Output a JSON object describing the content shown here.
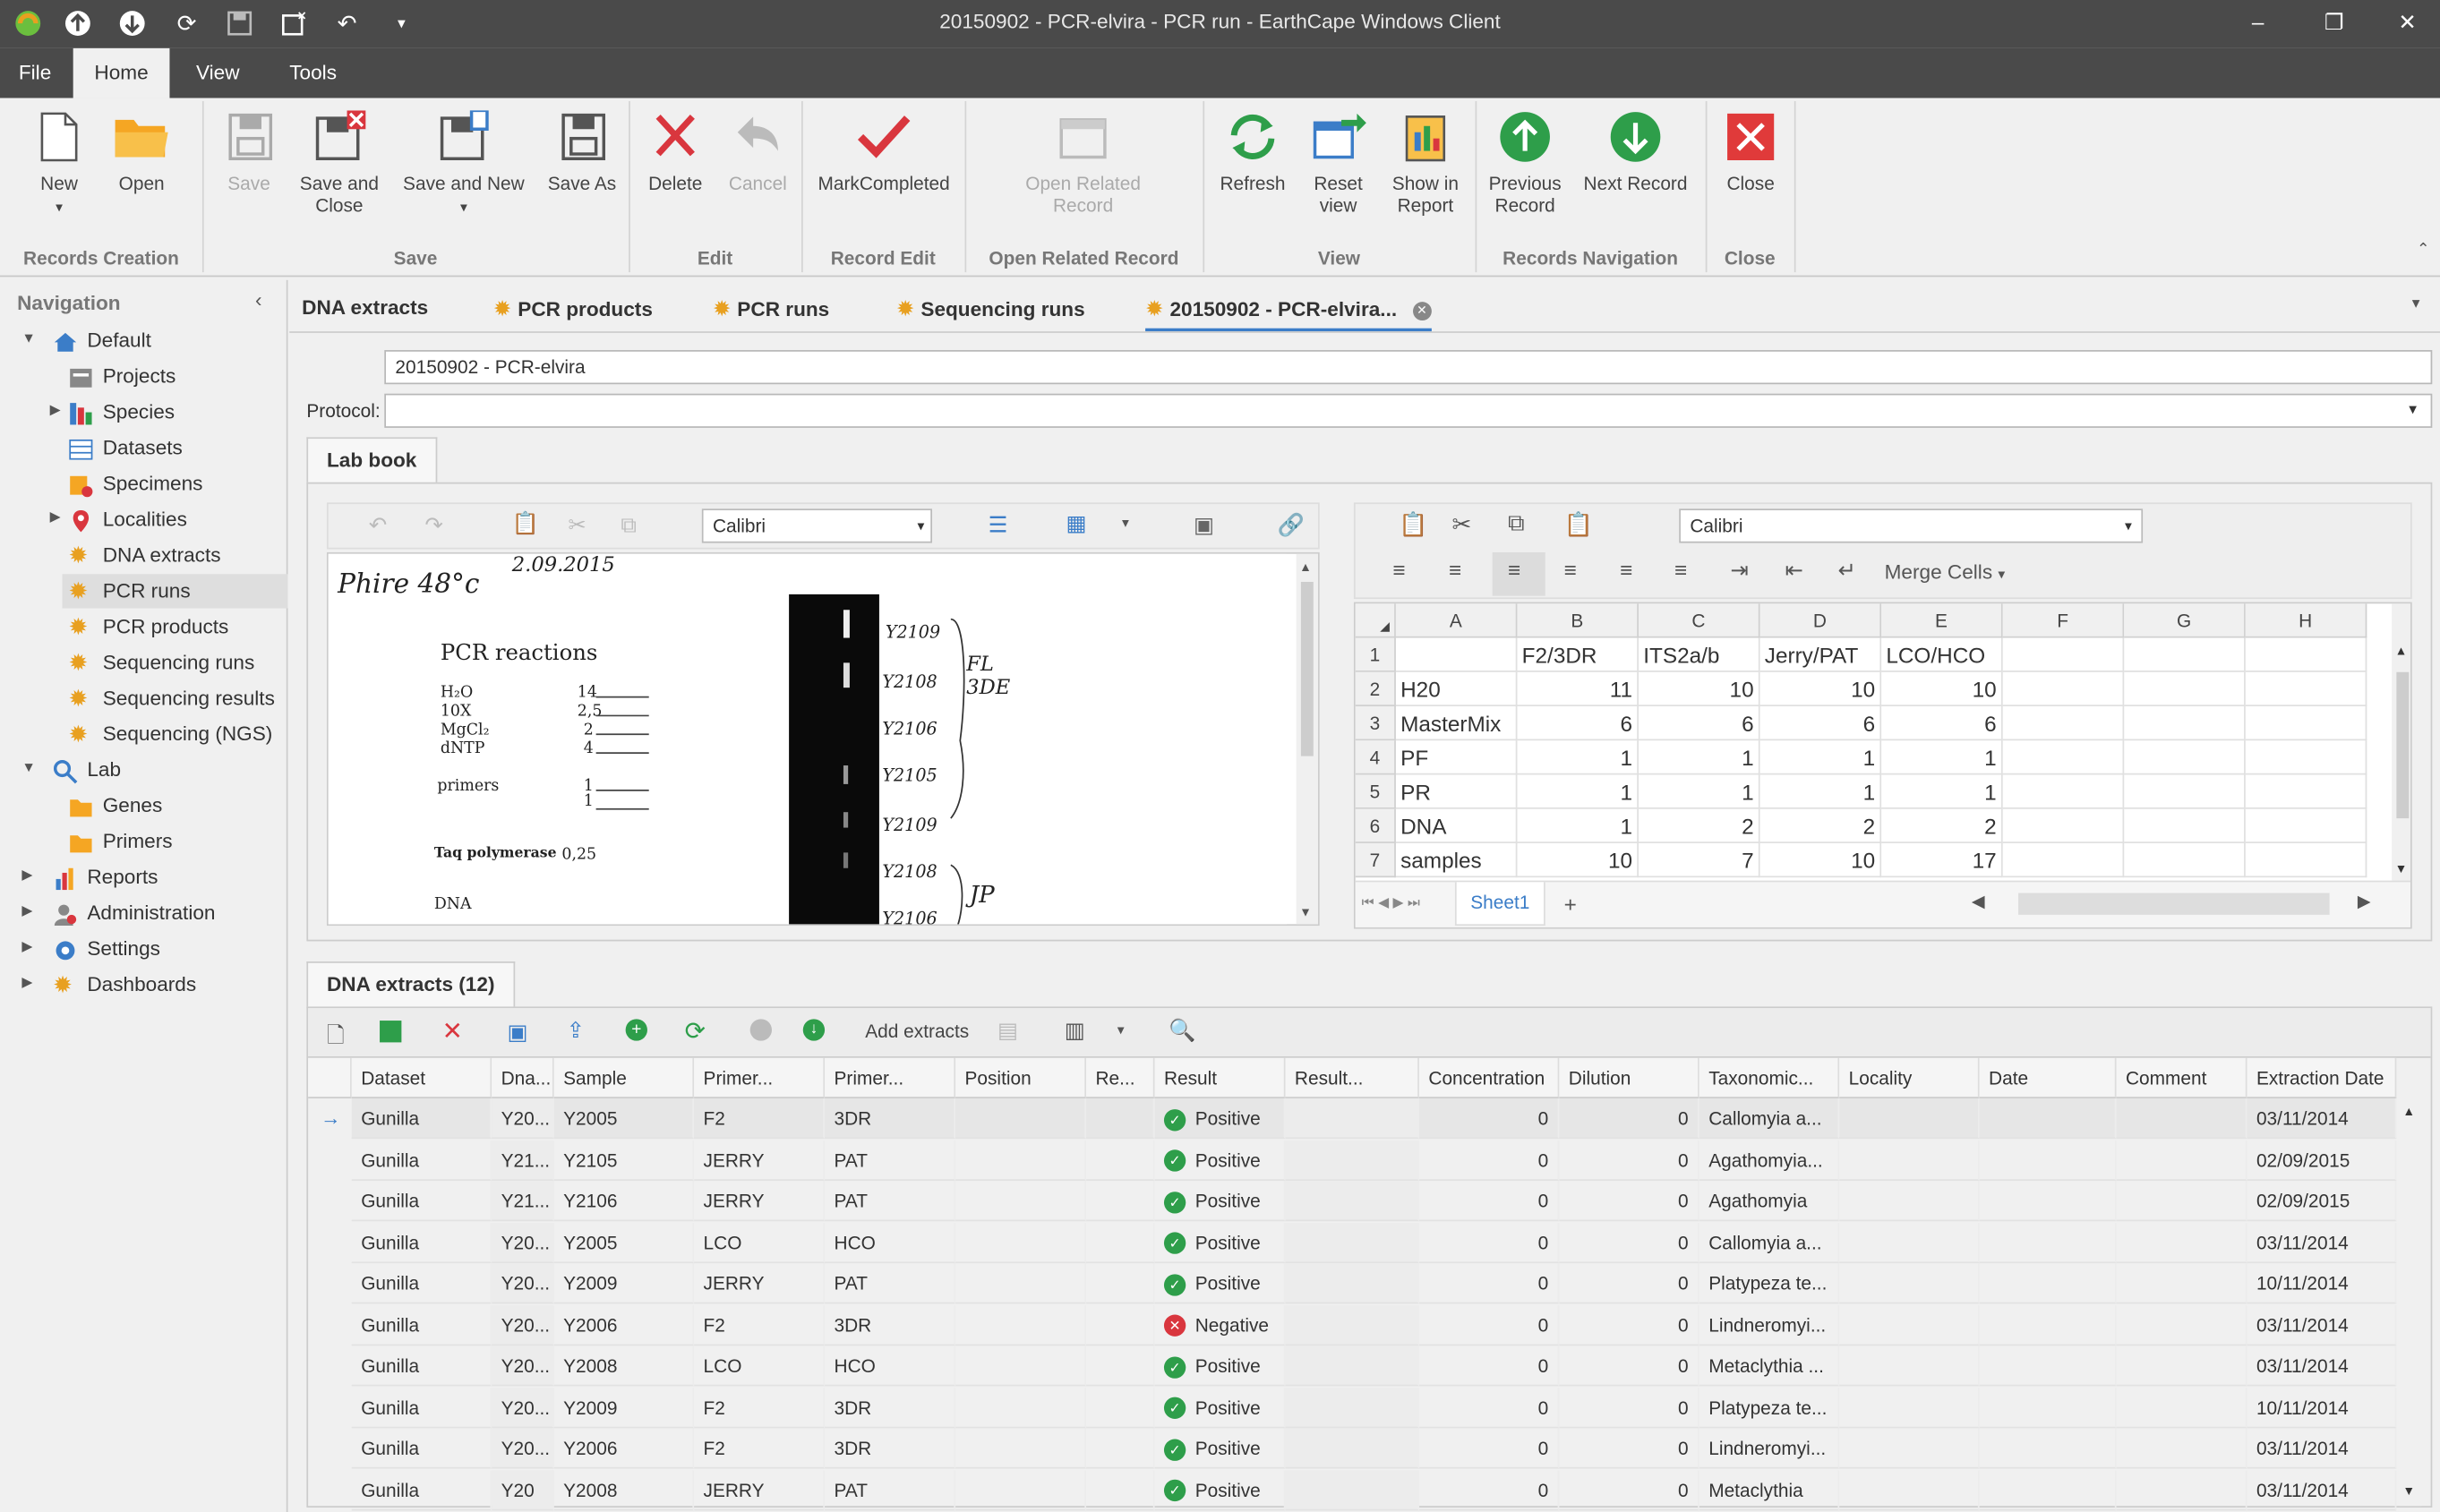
{
  "window": {
    "title": "20150902 - PCR-elvira - PCR run - EarthCape Windows Client",
    "minimize": "–",
    "restore": "❐",
    "close": "✕"
  },
  "menu": {
    "file": "File",
    "home": "Home",
    "view": "View",
    "tools": "Tools"
  },
  "ribbon": {
    "new": "New",
    "open": "Open",
    "save": "Save",
    "save_close": "Save and Close",
    "save_new": "Save and New",
    "save_as": "Save As",
    "delete": "Delete",
    "cancel": "Cancel",
    "mark_completed": "MarkCompleted",
    "open_related": "Open Related Record",
    "refresh": "Refresh",
    "reset_view": "Reset view",
    "show_report": "Show in Report",
    "previous": "Previous Record",
    "next": "Next Record",
    "close": "Close",
    "groups": {
      "records_creation": "Records Creation",
      "save": "Save",
      "edit": "Edit",
      "record_edit": "Record Edit",
      "open_related": "Open Related Record",
      "view": "View",
      "records_nav": "Records Navigation",
      "close": "Close"
    }
  },
  "nav": {
    "header": "Navigation",
    "items": [
      {
        "label": "Default"
      },
      {
        "label": "Projects"
      },
      {
        "label": "Species"
      },
      {
        "label": "Datasets"
      },
      {
        "label": "Specimens"
      },
      {
        "label": "Localities"
      },
      {
        "label": "DNA extracts"
      },
      {
        "label": "PCR runs"
      },
      {
        "label": "PCR products"
      },
      {
        "label": "Sequencing runs"
      },
      {
        "label": "Sequencing results"
      },
      {
        "label": "Sequencing (NGS)"
      },
      {
        "label": "Lab"
      },
      {
        "label": "Genes"
      },
      {
        "label": "Primers"
      },
      {
        "label": "Reports"
      },
      {
        "label": "Administration"
      },
      {
        "label": "Settings"
      },
      {
        "label": "Dashboards"
      }
    ]
  },
  "tabs": [
    "DNA extracts",
    "PCR products",
    "PCR runs",
    "Sequencing runs",
    "20150902 - PCR-elvira..."
  ],
  "form": {
    "name_value": "20150902 - PCR-elvira",
    "protocol_label": "Protocol:",
    "protocol_value": ""
  },
  "labbook": {
    "tab": "Lab book",
    "font": "Calibri",
    "handwriting": {
      "date": "2.09.2015",
      "title": "Phire 48°c",
      "heading": "PCR reactions",
      "h2o": "H₂O",
      "x10": "10X",
      "mgcl2": "MgCl₂",
      "dntp": "dNTP",
      "primers": "primers",
      "taq": "Taq polymerase",
      "dna": "DNA",
      "v1": "14",
      "v2": "2,5",
      "v3": "2",
      "v4": "4",
      "v5": "1",
      "v6": "1",
      "v7": "0,25",
      "n1": "Y2109",
      "n2": "Y2108",
      "n3": "Y2106",
      "n4": "Y2105",
      "n5": "Y2109",
      "n6": "Y2108",
      "n7": "Y2106",
      "g1": "FL 3DE",
      "g2": "JP"
    }
  },
  "sheet": {
    "font": "Calibri",
    "merge": "Merge Cells",
    "tab": "Sheet1",
    "add": "+",
    "columns": [
      "A",
      "B",
      "C",
      "D",
      "E",
      "F",
      "G",
      "H"
    ],
    "rows": [
      [
        "",
        "F2/3DR",
        "ITS2a/b",
        "Jerry/PAT",
        "LCO/HCO"
      ],
      [
        "H20",
        "11",
        "10",
        "10",
        "10"
      ],
      [
        "MasterMix",
        "6",
        "6",
        "6",
        "6"
      ],
      [
        "PF",
        "1",
        "1",
        "1",
        "1"
      ],
      [
        "PR",
        "1",
        "1",
        "1",
        "1"
      ],
      [
        "DNA",
        "1",
        "2",
        "2",
        "2"
      ],
      [
        "samples",
        "10",
        "7",
        "10",
        "17"
      ]
    ]
  },
  "extracts": {
    "tab": "DNA extracts (12)",
    "add_extracts": "Add extracts",
    "columns": [
      "Dataset",
      "Dna...",
      "Sample",
      "Primer...",
      "Primer...",
      "Position",
      "Re...",
      "Result",
      "Result...",
      "Concentration",
      "Dilution",
      "Taxonomic...",
      "Locality",
      "Date",
      "Comment",
      "Extraction Date"
    ],
    "rows": [
      {
        "dataset": "Gunilla",
        "dna": "Y20...",
        "sample": "Y2005",
        "p1": "F2",
        "p2": "3DR",
        "result": "Positive",
        "conc": "0",
        "dil": "0",
        "tax": "Callomyia a...",
        "ext": "03/11/2014"
      },
      {
        "dataset": "Gunilla",
        "dna": "Y21...",
        "sample": "Y2105",
        "p1": "JERRY",
        "p2": "PAT",
        "result": "Positive",
        "conc": "0",
        "dil": "0",
        "tax": "Agathomyia...",
        "ext": "02/09/2015"
      },
      {
        "dataset": "Gunilla",
        "dna": "Y21...",
        "sample": "Y2106",
        "p1": "JERRY",
        "p2": "PAT",
        "result": "Positive",
        "conc": "0",
        "dil": "0",
        "tax": "Agathomyia",
        "ext": "02/09/2015"
      },
      {
        "dataset": "Gunilla",
        "dna": "Y20...",
        "sample": "Y2005",
        "p1": "LCO",
        "p2": "HCO",
        "result": "Positive",
        "conc": "0",
        "dil": "0",
        "tax": "Callomyia a...",
        "ext": "03/11/2014"
      },
      {
        "dataset": "Gunilla",
        "dna": "Y20...",
        "sample": "Y2009",
        "p1": "JERRY",
        "p2": "PAT",
        "result": "Positive",
        "conc": "0",
        "dil": "0",
        "tax": "Platypeza te...",
        "ext": "10/11/2014"
      },
      {
        "dataset": "Gunilla",
        "dna": "Y20...",
        "sample": "Y2006",
        "p1": "F2",
        "p2": "3DR",
        "result": "Negative",
        "conc": "0",
        "dil": "0",
        "tax": "Lindneromyi...",
        "ext": "03/11/2014"
      },
      {
        "dataset": "Gunilla",
        "dna": "Y20...",
        "sample": "Y2008",
        "p1": "LCO",
        "p2": "HCO",
        "result": "Positive",
        "conc": "0",
        "dil": "0",
        "tax": "Metaclythia ...",
        "ext": "03/11/2014"
      },
      {
        "dataset": "Gunilla",
        "dna": "Y20...",
        "sample": "Y2009",
        "p1": "F2",
        "p2": "3DR",
        "result": "Positive",
        "conc": "0",
        "dil": "0",
        "tax": "Platypeza te...",
        "ext": "10/11/2014"
      },
      {
        "dataset": "Gunilla",
        "dna": "Y20...",
        "sample": "Y2006",
        "p1": "F2",
        "p2": "3DR",
        "result": "Positive",
        "conc": "0",
        "dil": "0",
        "tax": "Lindneromyi...",
        "ext": "03/11/2014"
      },
      {
        "dataset": "Gunilla",
        "dna": "Y20",
        "sample": "Y2008",
        "p1": "JERRY",
        "p2": "PAT",
        "result": "Positive",
        "conc": "0",
        "dil": "0",
        "tax": "Metaclythia",
        "ext": "03/11/2014"
      }
    ]
  },
  "colors": {
    "titlebar": "#4a4a4a",
    "accent": "#3b7dc8",
    "positive": "#2e9e4a",
    "negative": "#d9363e",
    "gear": "#e8a020"
  }
}
